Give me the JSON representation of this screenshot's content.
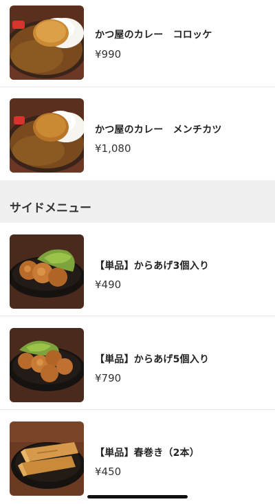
{
  "menu": {
    "items_top": [
      {
        "name": "かつ屋のカレー　コロッケ",
        "price": "¥990",
        "image": "curry-croquette-photo"
      },
      {
        "name": "かつ屋のカレー　メンチカツ",
        "price": "¥1,080",
        "image": "curry-menchi-katsu-photo"
      }
    ],
    "side_section_title": "サイドメニュー",
    "side_items": [
      {
        "name": "【単品】からあげ3個入り",
        "price": "¥490",
        "image": "karaage-3-photo"
      },
      {
        "name": "【単品】からあげ5個入り",
        "price": "¥790",
        "image": "karaage-5-photo"
      },
      {
        "name": "【単品】春巻き（2本）",
        "price": "¥450",
        "image": "harumaki-photo"
      }
    ]
  },
  "colors": {
    "section_background": "#f0f0f0",
    "divider": "#e8e8e8",
    "text": "#222222"
  }
}
